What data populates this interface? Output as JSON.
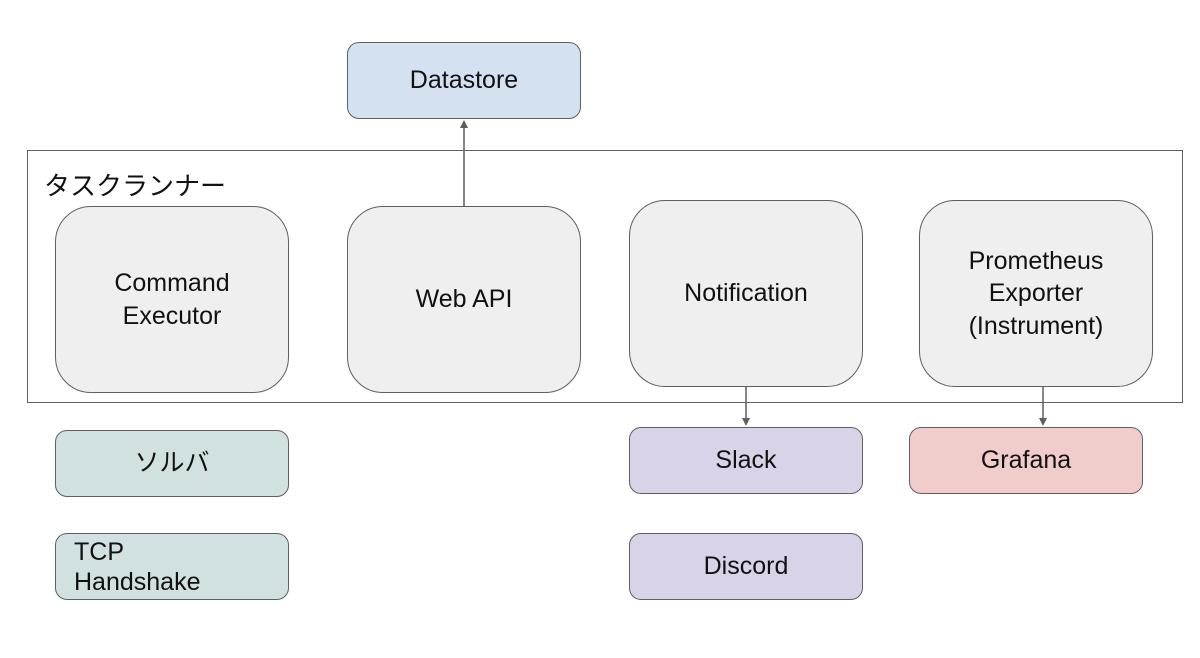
{
  "container": {
    "label": "タスクランナー"
  },
  "nodes": {
    "datastore": "Datastore",
    "command_executor": "Command\nExecutor",
    "web_api": "Web API",
    "notification": "Notification",
    "prometheus_exporter": "Prometheus\nExporter\n(Instrument)",
    "solver": "ソルバ",
    "tcp_handshake": "TCP\nHandshake",
    "slack": "Slack",
    "discord": "Discord",
    "grafana": "Grafana"
  },
  "edges": [
    {
      "from": "Web API",
      "to": "Datastore"
    },
    {
      "from": "Notification",
      "to": "Slack"
    },
    {
      "from": "Prometheus Exporter (Instrument)",
      "to": "Grafana"
    }
  ],
  "colors": {
    "border": "#5f5f5f",
    "gray_fill": "#efefef",
    "blue_fill": "#d4e1f1",
    "teal_fill": "#d1e0e1",
    "purple_fill": "#d9d3e7",
    "pink_fill": "#f0cdcb"
  }
}
